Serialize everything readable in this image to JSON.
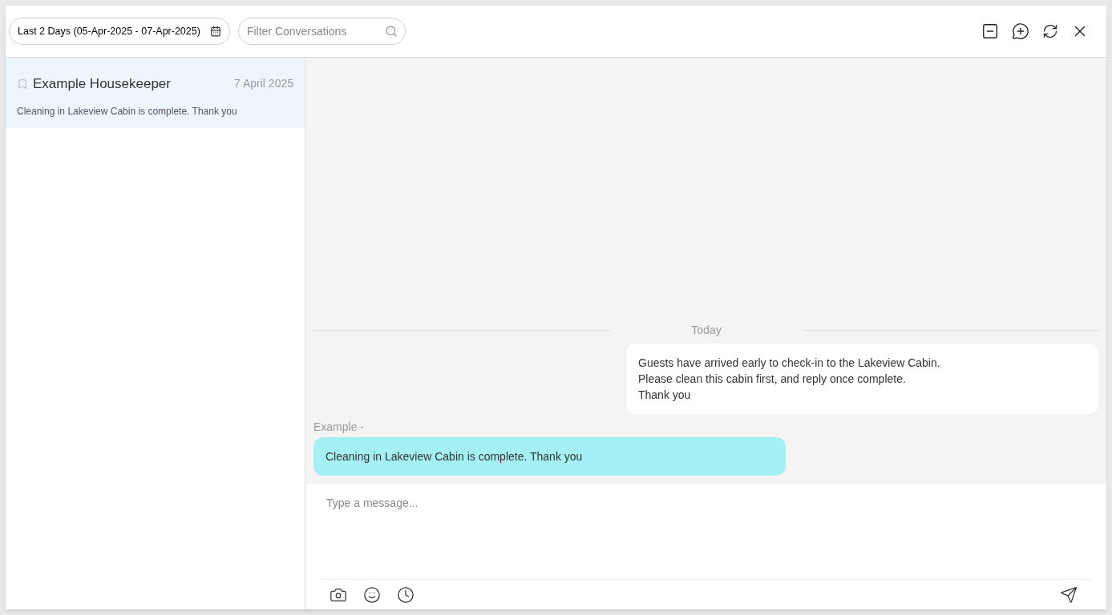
{
  "toolbar": {
    "date_range": "Last 2 Days (05-Apr-2025 - 07-Apr-2025)",
    "filter": {
      "placeholder": "Filter Conversations"
    }
  },
  "conversations": [
    {
      "name": "Example Housekeeper",
      "date": "7 April 2025",
      "preview": "Cleaning in Lakeview Cabin is complete. Thank you",
      "selected": true
    }
  ],
  "chat": {
    "day_divider": "Today",
    "messages": [
      {
        "kind": "sent",
        "lines": [
          "Guests have arrived early to check-in to the Lakeview Cabin.",
          "Please clean this cabin first, and reply once complete.",
          "Thank you"
        ]
      },
      {
        "kind": "received",
        "sender": "Example -",
        "lines": [
          "Cleaning in Lakeview Cabin is complete. Thank you"
        ]
      }
    ]
  },
  "composer": {
    "placeholder": "Type a message..."
  }
}
